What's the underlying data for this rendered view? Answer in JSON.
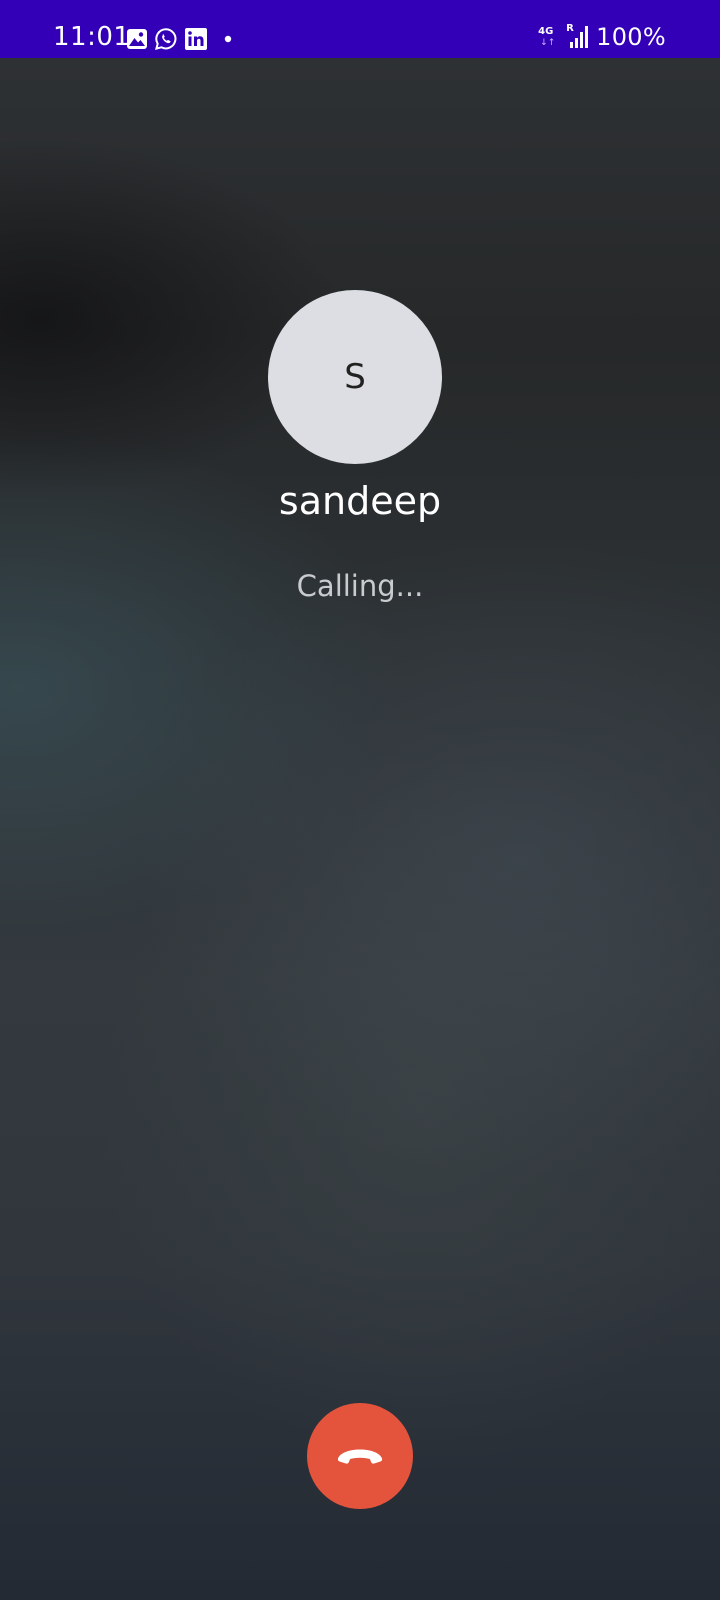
{
  "status_bar": {
    "time": "11:01",
    "notifications": [
      "gallery-icon",
      "whatsapp-icon",
      "linkedin-icon",
      "more-dot"
    ],
    "network": {
      "type": "4G",
      "arrows": "↓↑",
      "roaming": "R"
    },
    "battery": "100%",
    "background_color": "#3300b7"
  },
  "call": {
    "avatar_initial": "S",
    "caller_name": "sandeep",
    "status": "Calling...",
    "end_call_icon": "phone-hangup-icon",
    "end_call_color": "#e4543c"
  }
}
